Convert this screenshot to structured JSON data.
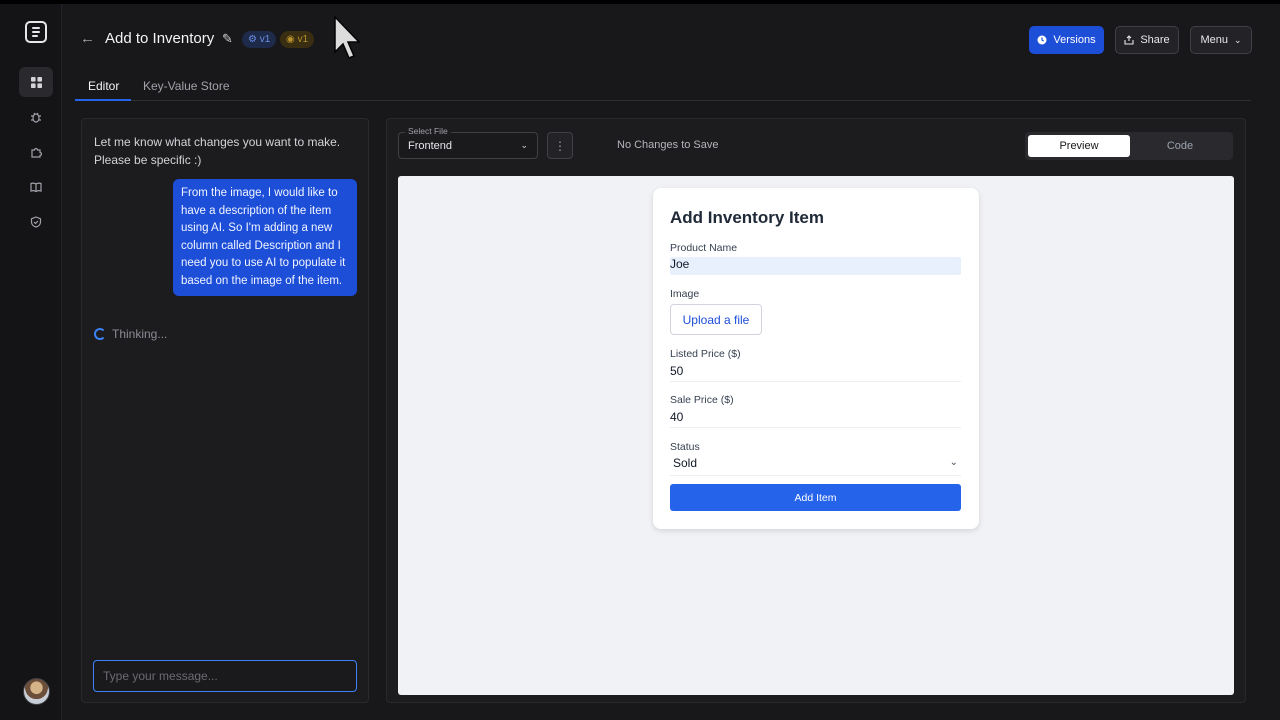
{
  "app": {
    "title": "Add to Inventory",
    "badges": [
      "v1",
      "v1"
    ],
    "header_buttons": {
      "versions": "Versions",
      "share": "Share",
      "menu": "Menu"
    },
    "accent_color": "#1d4ed8"
  },
  "tabs": [
    {
      "label": "Editor",
      "active": true
    },
    {
      "label": "Key-Value Store",
      "active": false
    }
  ],
  "sidebar": {
    "icons": [
      "logo-icon",
      "grid-icon",
      "bug-icon",
      "puzzle-icon",
      "book-icon",
      "shield-icon",
      "avatar"
    ]
  },
  "chat": {
    "intro": "Let me know what changes you want to make. Please be specific :)",
    "user_message": "From the image, I would like to have a description of the item using AI. So I'm adding a new column called Description and I need you to use AI to populate it based on the image of the item.",
    "status": "Thinking...",
    "input_placeholder": "Type your message..."
  },
  "editor": {
    "file_select_label": "Select File",
    "file_select_value": "Frontend",
    "save_status": "No Changes to Save",
    "view_toggle": {
      "preview": "Preview",
      "code": "Code",
      "active": "Preview"
    }
  },
  "preview_form": {
    "title": "Add Inventory Item",
    "product_name_label": "Product Name",
    "product_name_value": "Joe",
    "image_label": "Image",
    "upload_label": "Upload a file",
    "listed_price_label": "Listed Price ($)",
    "listed_price_value": "50",
    "sale_price_label": "Sale Price ($)",
    "sale_price_value": "40",
    "status_label": "Status",
    "status_value": "Sold",
    "submit_label": "Add Item"
  }
}
